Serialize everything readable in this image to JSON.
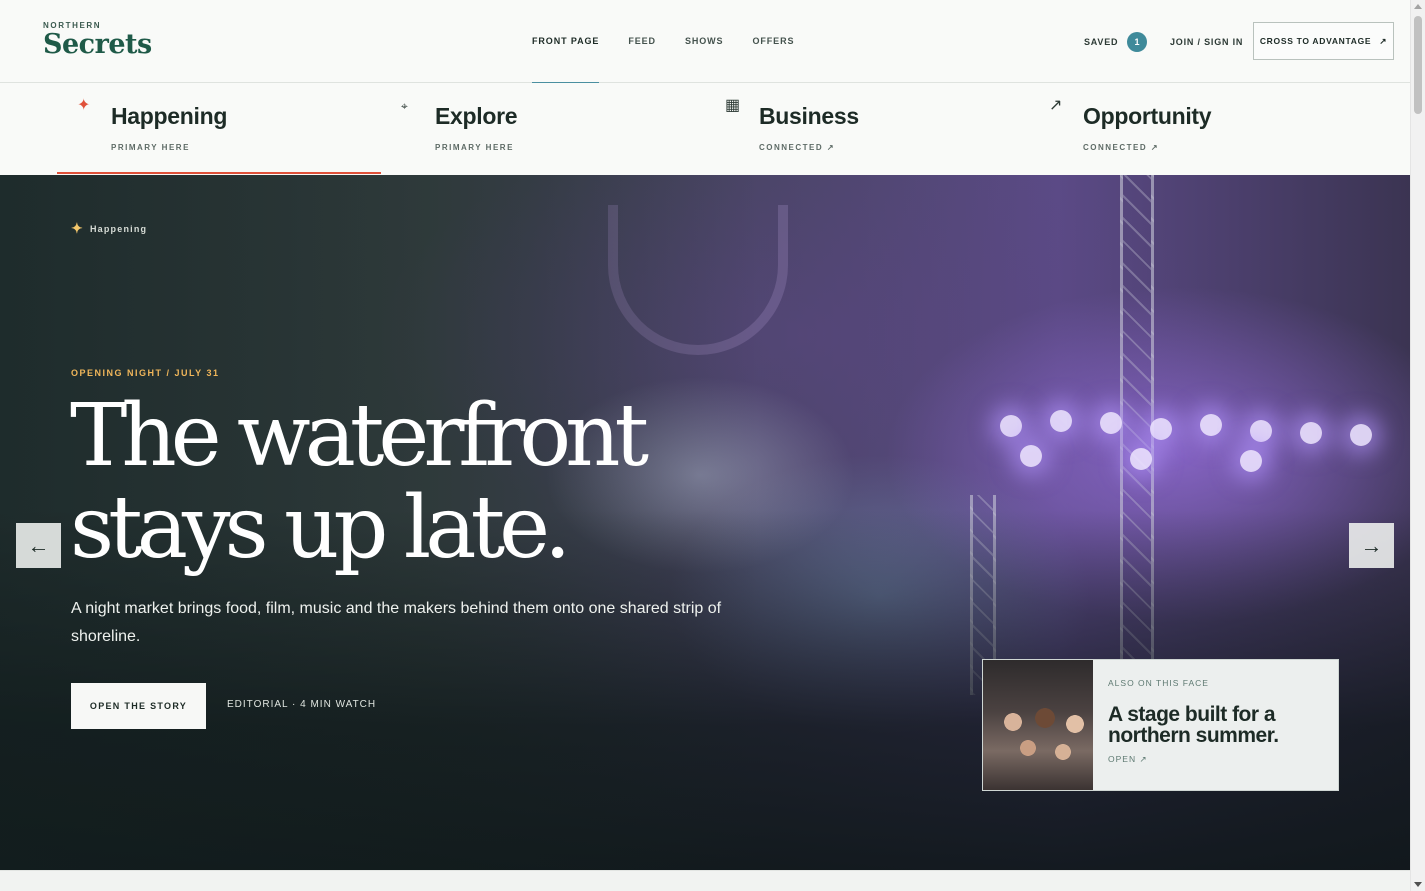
{
  "header": {
    "logo_kicker": "NORTHERN",
    "logo_name": "Secrets",
    "nav": [
      {
        "label": "FRONT PAGE",
        "active": true
      },
      {
        "label": "FEED",
        "active": false
      },
      {
        "label": "SHOWS",
        "active": false
      },
      {
        "label": "OFFERS",
        "active": false
      }
    ],
    "saved_label": "SAVED",
    "saved_count": "1",
    "join_label": "JOIN / SIGN IN",
    "cta_label": "CROSS TO ADVANTAGE",
    "cta_icon": "↗"
  },
  "categories": [
    {
      "icon": "✦",
      "icon_name": "sparkle-icon",
      "title": "Happening",
      "sub": "PRIMARY HERE",
      "active": true,
      "icon_color": "#e0513a"
    },
    {
      "icon": "⌖",
      "icon_name": "compass-icon",
      "title": "Explore",
      "sub": "PRIMARY HERE",
      "active": false
    },
    {
      "icon": "▦",
      "icon_name": "grid-icon",
      "title": "Business",
      "sub": "CONNECTED ↗",
      "active": false
    },
    {
      "icon": "↗",
      "icon_name": "arrow-up-right-icon",
      "title": "Opportunity",
      "sub": "CONNECTED ↗",
      "active": false
    }
  ],
  "hero": {
    "eyebrow": "Happening",
    "kicker": "OPENING NIGHT / JULY 31",
    "headline_line1": "The waterfront",
    "headline_line2": "stays up late.",
    "lede": "A night market brings food, film, music and the makers behind them onto one shared strip of shoreline.",
    "button_label": "OPEN THE STORY",
    "meta": "EDITORIAL · 4 MIN WATCH",
    "prev_arrow": "←",
    "next_arrow": "→"
  },
  "side_card": {
    "kicker": "ALSO ON THIS FACE",
    "title": "A stage built for a northern summer.",
    "link": "OPEN ↗"
  },
  "colors": {
    "accent": "#4a8fa0",
    "active_tab": "#e0513a",
    "kicker": "#f0b65a",
    "brand": "#1f5a48"
  }
}
